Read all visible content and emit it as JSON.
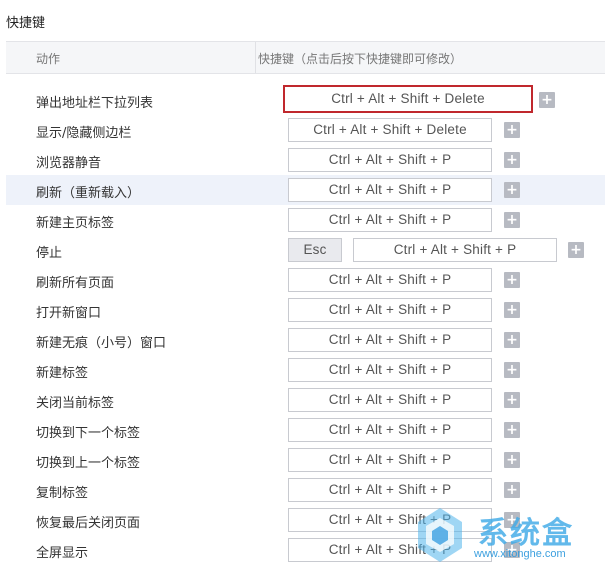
{
  "section_title": "快捷键",
  "header": {
    "col_action": "动作",
    "col_shortcut": "快捷键（点击后按下快捷键即可修改）"
  },
  "rows": [
    {
      "action": "弹出地址栏下拉列表",
      "shortcut": "Ctrl  +  Alt  +  Shift  +  Delete",
      "selected": true
    },
    {
      "action": "显示/隐藏侧边栏",
      "shortcut": "Ctrl  +  Alt  +  Shift  +  Delete"
    },
    {
      "action": "浏览器静音",
      "shortcut": "Ctrl  +  Alt  +  Shift  +  P"
    },
    {
      "action": "刷新（重新载入）",
      "shortcut": "Ctrl  +  Alt  +  Shift  +  P",
      "highlight": true
    },
    {
      "action": "新建主页标签",
      "shortcut": "Ctrl  +  Alt  +  Shift  +  P"
    },
    {
      "action": "停止",
      "shortcut_primary": "Esc",
      "shortcut": "Ctrl  +  Alt  +  Shift  +  P"
    },
    {
      "action": "刷新所有页面",
      "shortcut": "Ctrl  +  Alt  +  Shift  +  P"
    },
    {
      "action": "打开新窗口",
      "shortcut": "Ctrl  +  Alt  +  Shift  +  P"
    },
    {
      "action": "新建无痕（小号）窗口",
      "shortcut": "Ctrl  +  Alt  +  Shift  +  P"
    },
    {
      "action": "新建标签",
      "shortcut": "Ctrl  +  Alt  +  Shift  +  P"
    },
    {
      "action": "关闭当前标签",
      "shortcut": "Ctrl  +  Alt  +  Shift  +  P"
    },
    {
      "action": "切换到下一个标签",
      "shortcut": "Ctrl  +  Alt  +  Shift  +  P"
    },
    {
      "action": "切换到上一个标签",
      "shortcut": "Ctrl  +  Alt  +  Shift  +  P"
    },
    {
      "action": "复制标签",
      "shortcut": "Ctrl  +  Alt  +  Shift  +  P"
    },
    {
      "action": "恢复最后关闭页面",
      "shortcut": "Ctrl  +  Alt  +  Shift  +  P"
    },
    {
      "action": "全屏显示",
      "shortcut": "Ctrl  +  Alt  +  Shift  +  P"
    }
  ],
  "add_label": "+",
  "watermark": {
    "text": "系统盒",
    "url": "www.xitonghe.com"
  },
  "colors": {
    "selected_border": "#c0282d",
    "row_highlight": "#eef2fa",
    "plus_bg": "#b7bac2",
    "watermark": "#40aae6"
  }
}
